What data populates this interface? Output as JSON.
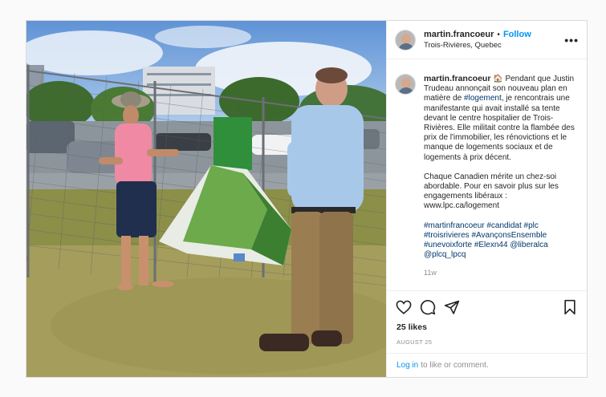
{
  "post": {
    "username": "martin.francoeur",
    "separator": "•",
    "follow_label": "Follow",
    "location": "Trois-Rivières, Quebec",
    "more_label": "•••"
  },
  "caption": {
    "username": "martin.francoeur",
    "emoji": "🏠",
    "text_1": "Pendant que Justin Trudeau annonçait son nouveau plan en matière de ",
    "tag_logement": "#logement",
    "text_2": ", je rencontrais une manifestante qui avait installé sa tente devant le centre hospitalier de Trois-Rivières. Elle militait contre la flambée des prix de l'immobilier, les rénovictions et le manque de logements sociaux et de logements à prix décent.",
    "para_2": "Chaque Canadien mérite un chez-soi abordable. Pour en savoir plus sur les engagements libéraux : www.lpc.ca/logement",
    "hashtags": [
      "#martinfrancoeur",
      "#candidat",
      "#plc",
      "#troisrivieres",
      "#AvançonsEnsemble",
      "#unevoixforte",
      "#Elexn44",
      "@liberalca",
      "@plcq_lpcq"
    ],
    "time_ago": "11w"
  },
  "stats": {
    "likes": "25 likes",
    "date": "AUGUST 25"
  },
  "login": {
    "link": "Log in",
    "text": "to like or comment."
  },
  "icons": [
    "heart-icon",
    "comment-icon",
    "share-icon",
    "bookmark-icon"
  ]
}
